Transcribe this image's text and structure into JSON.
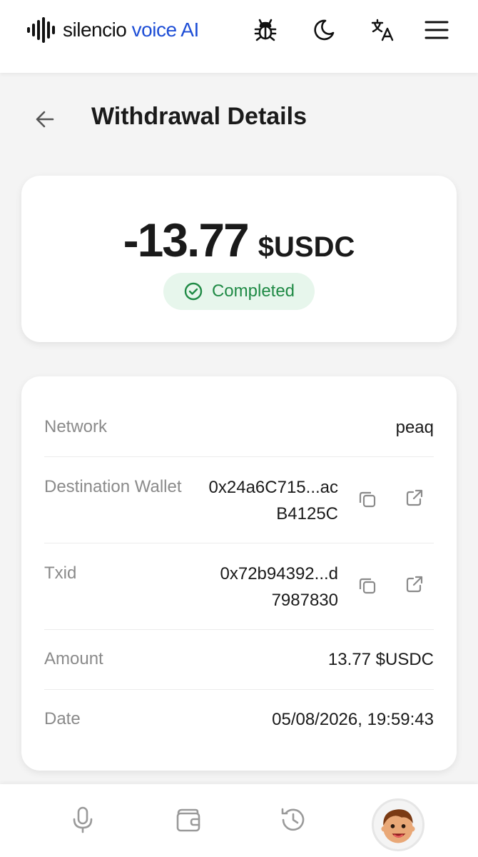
{
  "header": {
    "brand_part1": "silencio",
    "brand_part2": "voice AI",
    "icons": [
      "bug-icon",
      "moon-icon",
      "translate-icon",
      "menu-icon"
    ]
  },
  "page": {
    "title": "Withdrawal Details"
  },
  "summary": {
    "amount": "-13.77",
    "unit": "$USDC",
    "status": "Completed",
    "status_color": "#1f8a45",
    "status_bg": "#e7f6ec"
  },
  "details": {
    "network_label": "Network",
    "network_value": "peaq",
    "wallet_label": "Destination Wallet",
    "wallet_line1": "0x24a6C715...ac",
    "wallet_line2": "B4125C",
    "txid_label": "Txid",
    "txid_line1": "0x72b94392...d",
    "txid_line2": "7987830",
    "amount_label": "Amount",
    "amount_value": "13.77 $USDC",
    "date_label": "Date",
    "date_value": "05/08/2026, 19:59:43"
  },
  "bottom_nav": {
    "items": [
      "microphone-icon",
      "wallet-icon",
      "history-icon",
      "avatar"
    ]
  },
  "colors": {
    "brand_blue": "#1f4fd6",
    "background": "#f4f4f4"
  }
}
